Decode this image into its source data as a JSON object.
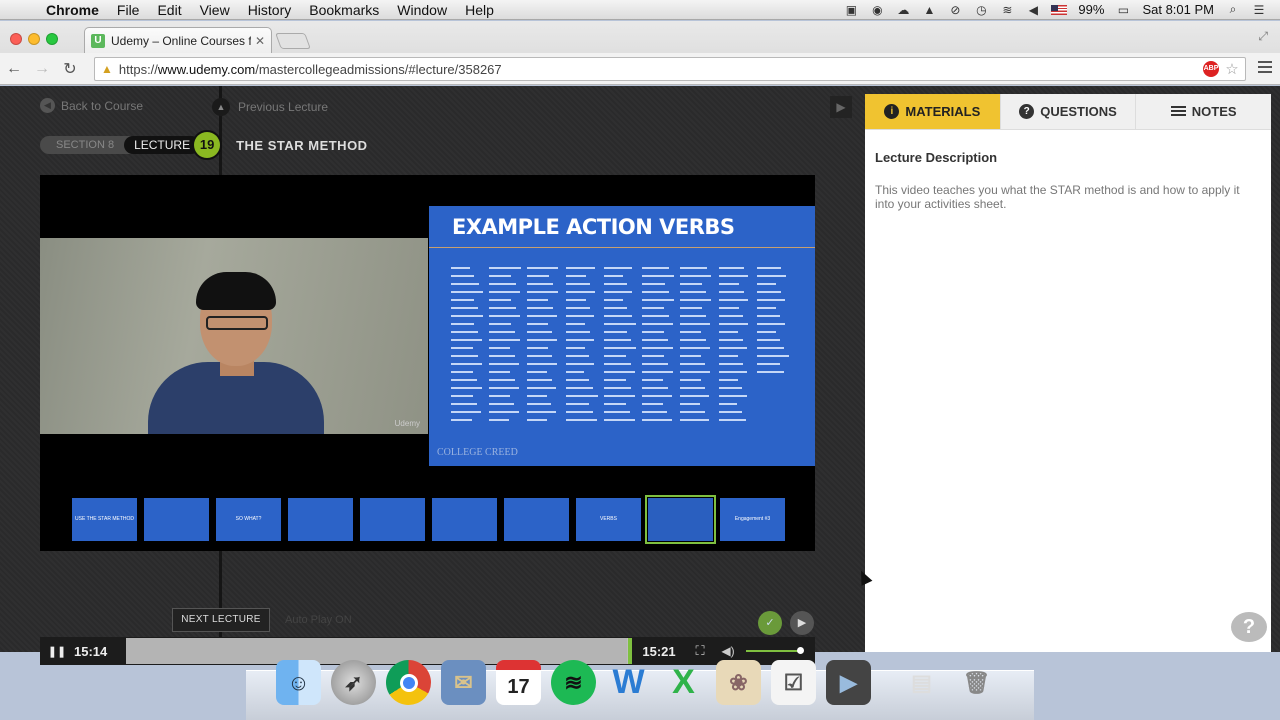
{
  "menubar": {
    "app": "Chrome",
    "items": [
      "File",
      "Edit",
      "View",
      "History",
      "Bookmarks",
      "Window",
      "Help"
    ],
    "battery": "99%",
    "clock": "Sat 8:01 PM"
  },
  "browser": {
    "tab_title": "Udemy – Online Courses f",
    "url_prefix": "https://",
    "url_host": "www.udemy.com",
    "url_path": "/mastercollegeadmissions/#lecture/358267",
    "abp_label": "ABP"
  },
  "course": {
    "back_label": "Back to Course",
    "prev_label": "Previous Lecture",
    "section_label": "SECTION 8",
    "lecture_label": "LECTURE",
    "lecture_number": "19",
    "lecture_title": "THE STAR METHOD"
  },
  "video": {
    "camera_watermark": "Udemy",
    "slide_title": "EXAMPLE ACTION VERBS",
    "slide_logo": "COLLEGE CREED",
    "thumbnails": [
      {
        "label": "USE THE STAR METHOD"
      },
      {
        "label": ""
      },
      {
        "label": "SO WHAT?"
      },
      {
        "label": ""
      },
      {
        "label": ""
      },
      {
        "label": ""
      },
      {
        "label": ""
      },
      {
        "label": "VERBS"
      },
      {
        "label": ""
      },
      {
        "label": "Engagement #3"
      }
    ],
    "current_time": "15:14",
    "total_time": "15:21",
    "progress_fraction": 0.99,
    "volume_fraction": 1.0
  },
  "footer": {
    "next_label": "NEXT LECTURE",
    "autoplay_label": "Auto Play ON"
  },
  "panel": {
    "tabs": [
      {
        "label": "MATERIALS",
        "icon": "info-icon"
      },
      {
        "label": "QUESTIONS",
        "icon": "question-icon"
      },
      {
        "label": "NOTES",
        "icon": "list-icon"
      }
    ],
    "heading": "Lecture Description",
    "description": "This video teaches you what the STAR method is and how to apply it into your activities sheet."
  },
  "colors": {
    "accent_yellow": "#f0c330",
    "udemy_green": "#8ab821",
    "slide_blue": "#2c63c8"
  }
}
